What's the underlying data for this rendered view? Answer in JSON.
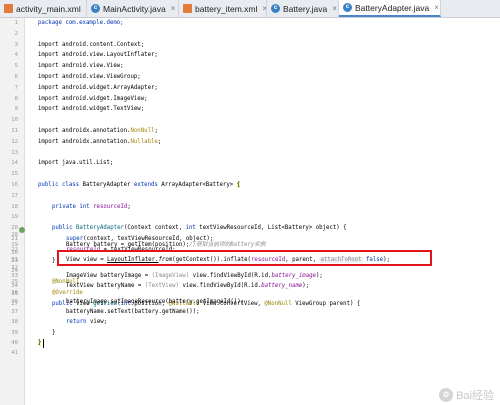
{
  "tabs": [
    {
      "label": "activity_main.xml",
      "icon": "xml-file-icon",
      "active": false
    },
    {
      "label": "MainActivity.java",
      "icon": "java-class-icon",
      "active": false
    },
    {
      "label": "battery_item.xml",
      "icon": "xml-file-icon",
      "active": false
    },
    {
      "label": "Battery.java",
      "icon": "java-class-icon",
      "active": false
    },
    {
      "label": "BatteryAdapter.java",
      "icon": "java-class-icon",
      "active": true
    }
  ],
  "line_numbers": [
    "1",
    "2",
    "3",
    "4",
    "5",
    "6",
    "7",
    "8",
    "9",
    "10",
    "11",
    "12",
    "13",
    "14",
    "15",
    "16",
    "17",
    "18",
    "19",
    "20",
    "21",
    "22",
    "23",
    "24",
    "25",
    "26",
    "27",
    "28",
    "29",
    "30",
    "31",
    "32",
    "33",
    "34",
    "35",
    "36",
    "37",
    "38",
    "39",
    "40",
    "41"
  ],
  "code": {
    "l1": "package com.example.demo;",
    "l3": "import android.content.Context;",
    "l4": "import android.view.LayoutInflater;",
    "l5": "import android.view.View;",
    "l6": "import android.view.ViewGroup;",
    "l7": "import android.widget.ArrayAdapter;",
    "l8": "import android.widget.ImageView;",
    "l9": "import android.widget.TextView;",
    "l11a": "import androidx.annotation.",
    "l11b": "NonNull",
    "l11c": ";",
    "l12a": "import androidx.annotation.",
    "l12b": "Nullable",
    "l12c": ";",
    "l14": "import java.util.List;",
    "l16a": "public class ",
    "l16b": "BatteryAdapter ",
    "l16c": "extends ",
    "l16d": "ArrayAdapter<Battery> ",
    "l16e": "{",
    "l18a": "private int ",
    "l18b": "resourceId",
    "l18c": ";",
    "l20a": "public ",
    "l20b": "BatteryAdapter",
    "l20c": "(Context context, ",
    "l20d": "int ",
    "l20e": "textViewResourceId, List<Battery> object) {",
    "l21a": "super",
    "l21b": "(context, textViewResourceId, object);",
    "l22a": "resourceId",
    "l22b": " = textViewResourceId;",
    "l23": "}",
    "l25": "@NonNull",
    "l26": "@Override",
    "l27a": "public ",
    "l27b": "View ",
    "l27c": "getView",
    "l27d": "(",
    "l27e": "int ",
    "l27f": "position, ",
    "l27g": "@Nullable ",
    "l27h": "View convertView, ",
    "l27i": "@NonNull ",
    "l27j": "ViewGroup parent) {",
    "l29a": "Battery battery = getItem(position);",
    "l29b": "//获取当前项的Battery实例",
    "l31a": "View view = ",
    "l31b": "LayoutInflater.",
    "l31c": "from",
    "l31d": "(getContext()).",
    "l31e": "inflate",
    "l31f": "(",
    "l31g": "resourceId",
    "l31h": ", parent, ",
    "l31i": "attachToRoot",
    "l31j": " false",
    "l31k": ");",
    "l33a": "ImageView batteryImage = ",
    "l33b": "(ImageView) ",
    "l33c": "view.findViewById(R.id.",
    "l33d": "battery_image",
    "l33e": ");",
    "l34a": "TextView batteryName = ",
    "l34b": "(TextView) ",
    "l34c": "view.findViewById(R.id.",
    "l34d": "battery_name",
    "l34e": ");",
    "l36": "batteryImage.setImageResource(battery.getImageId());",
    "l37": "batteryName.setText(battery.getName());",
    "l38a": "return ",
    "l38b": "view;",
    "l39": "}",
    "l40": "}"
  },
  "watermark": {
    "text": "Bai经验",
    "logo": "baidu-paw-icon"
  },
  "colors": {
    "highlight_border": "#e1141a",
    "keyword": "#0033b3",
    "field": "#871094",
    "annotation": "#9e880d",
    "comment": "#8c8c8c"
  }
}
